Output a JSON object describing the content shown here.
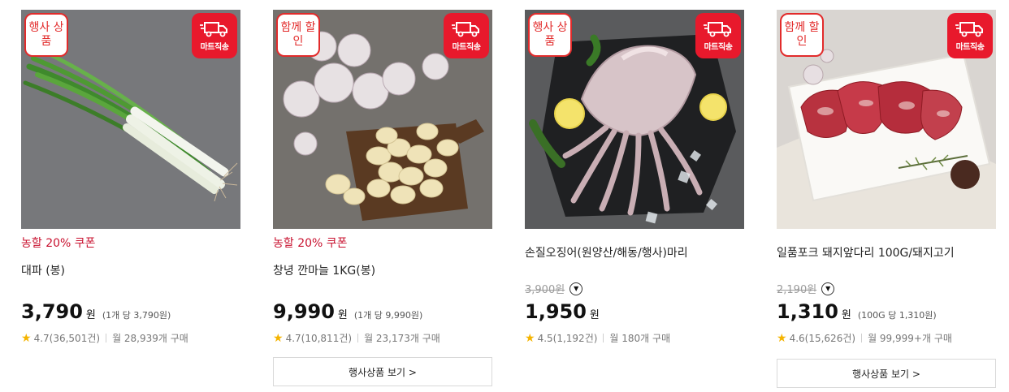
{
  "products": [
    {
      "badge": "행사 상품",
      "delivery_label": "마트직송",
      "coupon": "농할 20% 쿠폰",
      "name": "대파 (봉)",
      "price": "3,790",
      "won": "원",
      "unit_price": "(1개 당 3,790원)",
      "rating": "4.7",
      "reviews": "(36,501건)",
      "monthly": "월 28,939개 구매",
      "image": "green-onion-photo",
      "more_button": ""
    },
    {
      "badge": "함께 할인",
      "delivery_label": "마트직송",
      "coupon": "농할 20% 쿠폰",
      "name": "창녕 깐마늘 1KG(봉)",
      "price": "9,990",
      "won": "원",
      "unit_price": "(1개 당 9,990원)",
      "rating": "4.7",
      "reviews": "(10,811건)",
      "monthly": "월 23,173개 구매",
      "image": "garlic-photo",
      "more_button": "행사상품 보기 >"
    },
    {
      "badge": "행사 상품",
      "delivery_label": "마트직송",
      "coupon": "",
      "name": "손질오징어(원양산/해동/행사)마리",
      "original_price": "3,900원",
      "price": "1,950",
      "won": "원",
      "unit_price": "",
      "rating": "4.5",
      "reviews": "(1,192건)",
      "monthly": "월 180개 구매",
      "image": "squid-photo",
      "more_button": ""
    },
    {
      "badge": "함께 할인",
      "delivery_label": "마트직송",
      "coupon": "",
      "name": "일품포크 돼지앞다리 100G/돼지고기",
      "original_price": "2,190원",
      "price": "1,310",
      "won": "원",
      "unit_price": "(100G 당 1,310원)",
      "rating": "4.6",
      "reviews": "(15,626건)",
      "monthly": "월 99,999+개 구매",
      "image": "pork-photo",
      "more_button": "행사상품 보기 >"
    }
  ],
  "colors": {
    "accent_red": "#e8192c",
    "coupon_red": "#c8102e",
    "star": "#f5b400"
  }
}
